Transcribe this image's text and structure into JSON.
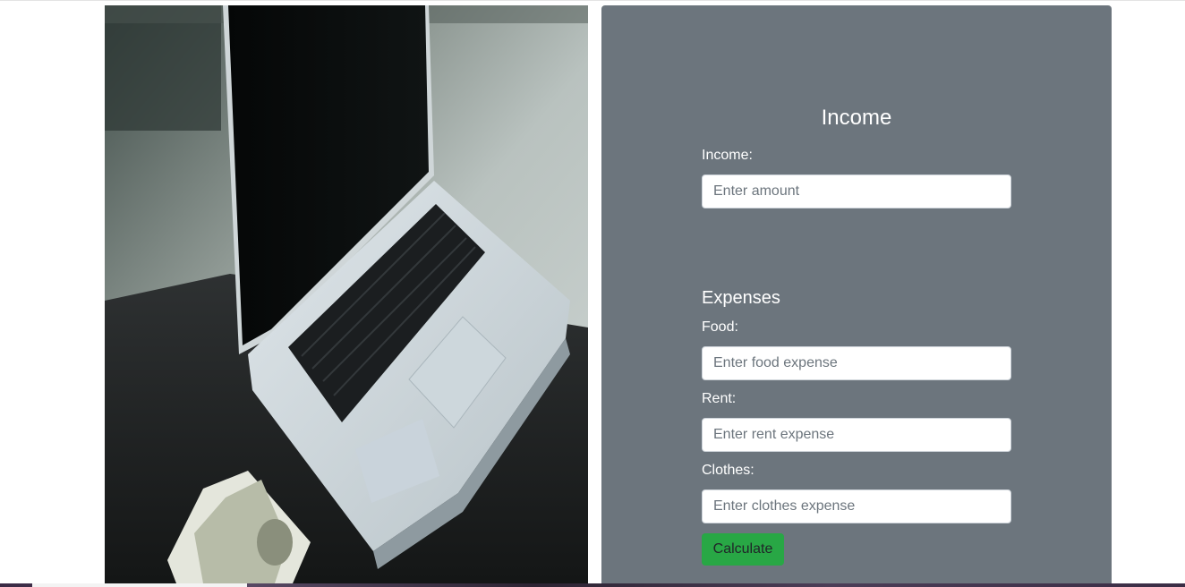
{
  "photo": {
    "alt": "laptop-with-money-photo"
  },
  "income": {
    "title": "Income",
    "label": "Income:",
    "placeholder": "Enter amount"
  },
  "expenses": {
    "title": "Expenses",
    "food_label": "Food:",
    "food_placeholder": "Enter food expense",
    "rent_label": "Rent:",
    "rent_placeholder": "Enter rent expense",
    "clothes_label": "Clothes:",
    "clothes_placeholder": "Enter clothes expense"
  },
  "actions": {
    "calculate_label": "Calculate"
  },
  "colors": {
    "panel": "#6c757d",
    "button": "#28a745"
  }
}
